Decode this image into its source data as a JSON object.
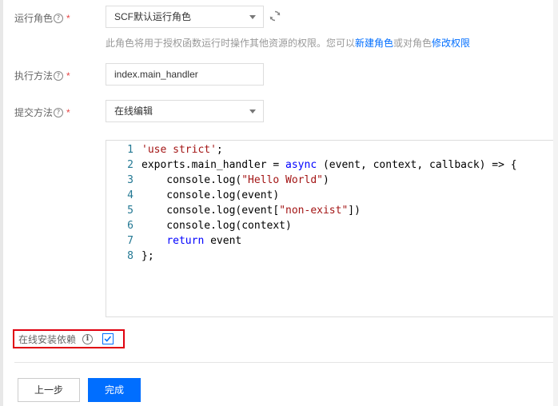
{
  "form": {
    "role": {
      "label": "运行角色",
      "help": "?",
      "required": "*",
      "value": "SCF默认运行角色",
      "hint_prefix": "此角色将用于授权函数运行时操作其他资源的权限。您可以",
      "hint_link_new": "新建角色",
      "hint_middle": "或对角色",
      "hint_link_edit": "修改权限"
    },
    "handler": {
      "label": "执行方法",
      "help": "?",
      "required": "*",
      "value": "index.main_handler"
    },
    "submit": {
      "label": "提交方法",
      "help": "?",
      "required": "*",
      "value": "在线编辑"
    },
    "install_deps": {
      "label": "在线安装依赖",
      "info": "i",
      "checked": true
    }
  },
  "editor": {
    "lines": [
      {
        "num": "1",
        "tokens": [
          {
            "t": "'use strict'",
            "c": "str"
          },
          {
            "t": ";",
            "c": ""
          }
        ]
      },
      {
        "num": "2",
        "tokens": [
          {
            "t": "exports.main_handler = ",
            "c": ""
          },
          {
            "t": "async",
            "c": "kw"
          },
          {
            "t": " (event, context, callback) => {",
            "c": ""
          }
        ]
      },
      {
        "num": "3",
        "tokens": [
          {
            "t": "    console.log(",
            "c": ""
          },
          {
            "t": "\"Hello World\"",
            "c": "str"
          },
          {
            "t": ")",
            "c": ""
          }
        ]
      },
      {
        "num": "4",
        "tokens": [
          {
            "t": "    console.log(event)",
            "c": ""
          }
        ]
      },
      {
        "num": "5",
        "tokens": [
          {
            "t": "    console.log(event[",
            "c": ""
          },
          {
            "t": "\"non-exist\"",
            "c": "str"
          },
          {
            "t": "])",
            "c": ""
          }
        ]
      },
      {
        "num": "6",
        "tokens": [
          {
            "t": "    console.log(context)",
            "c": ""
          }
        ]
      },
      {
        "num": "7",
        "tokens": [
          {
            "t": "    ",
            "c": ""
          },
          {
            "t": "return",
            "c": "kw"
          },
          {
            "t": " event",
            "c": ""
          }
        ]
      },
      {
        "num": "8",
        "tokens": [
          {
            "t": "};",
            "c": ""
          }
        ]
      }
    ]
  },
  "buttons": {
    "prev": "上一步",
    "done": "完成"
  },
  "colors": {
    "accent": "#006eff",
    "required": "#e54545",
    "highlight_box": "#e0000f",
    "string": "#a31515",
    "keyword": "#0000ff",
    "line_number": "#237893"
  },
  "icons": {
    "refresh": "refresh-icon",
    "dropdown": "chevron-down-icon",
    "help": "question-circle-icon",
    "info": "info-circle-icon",
    "check": "check-icon"
  }
}
